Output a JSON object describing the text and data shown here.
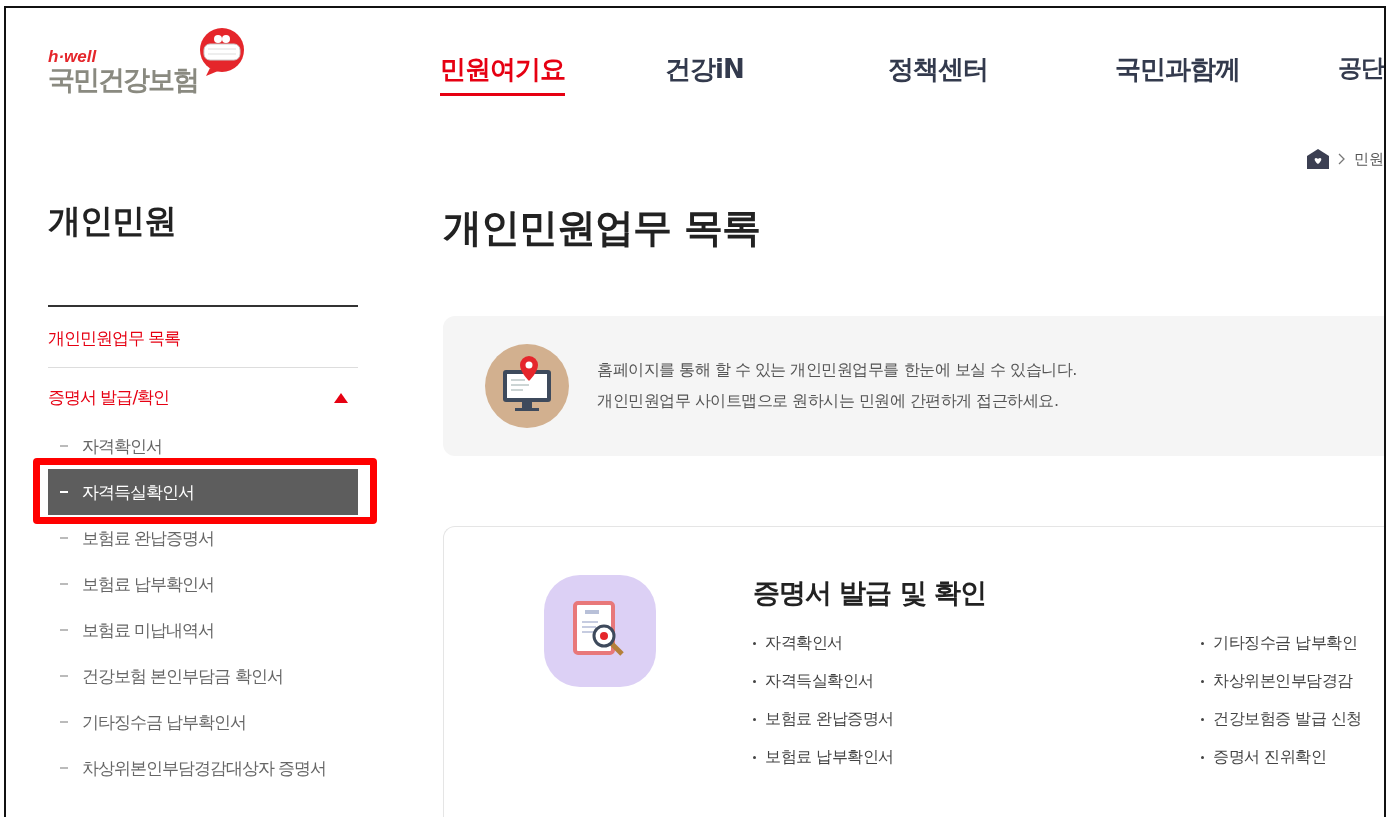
{
  "logo": {
    "tagline": "h·well",
    "name": "국민건강보험"
  },
  "nav": [
    {
      "label": "민원여기요",
      "selected": true
    },
    {
      "label": "건강iN",
      "selected": false
    },
    {
      "label": "정책센터",
      "selected": false
    },
    {
      "label": "국민과함께",
      "selected": false
    },
    {
      "label": "공단",
      "selected": false
    }
  ],
  "breadcrumb": [
    "민원"
  ],
  "sidebar": {
    "title": "개인민원",
    "items": [
      {
        "label": "개인민원업무 목록",
        "selected": true
      },
      {
        "label": "증명서 발급/확인",
        "selected": true,
        "expanded": true,
        "children": [
          {
            "label": "자격확인서",
            "selected": false
          },
          {
            "label": "자격득실확인서",
            "selected": true
          },
          {
            "label": "보험료 완납증명서",
            "selected": false
          },
          {
            "label": "보험료 납부확인서",
            "selected": false
          },
          {
            "label": "보험료 미납내역서",
            "selected": false
          },
          {
            "label": "건강보험 본인부담금 확인서",
            "selected": false
          },
          {
            "label": "기타징수금 납부확인서",
            "selected": false
          },
          {
            "label": "차상위본인부담경감대상자 증명서",
            "selected": false
          }
        ]
      }
    ]
  },
  "page_title": "개인민원업무 목록",
  "info": [
    "홈페이지를 통해 할 수 있는 개인민원업무를 한눈에 보실 수 있습니다.",
    "개인민원업무 사이트맵으로 원하시는 민원에 간편하게 접근하세요."
  ],
  "card": {
    "title": "증명서 발급 및 확인",
    "columns": [
      [
        "자격확인서",
        "자격득실확인서",
        "보험료 완납증명서",
        "보험료 납부확인서"
      ],
      [
        "기타징수금 납부확인",
        "차상위본인부담경감",
        "건강보험증 발급 신청",
        "증명서 진위확인"
      ]
    ]
  }
}
